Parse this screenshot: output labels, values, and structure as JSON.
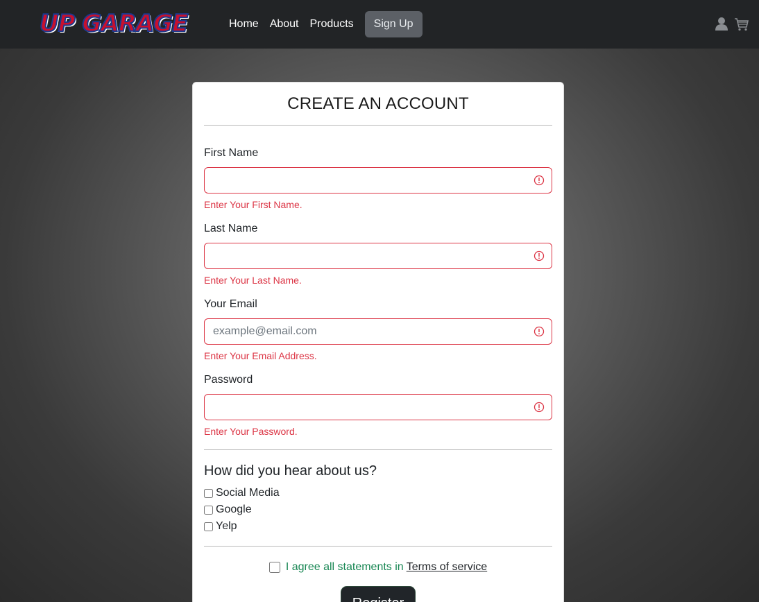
{
  "nav": {
    "brand": "UP GARAGE",
    "links": [
      "Home",
      "About",
      "Products"
    ],
    "signup": "Sign Up",
    "icons": [
      "user-icon",
      "cart-icon"
    ]
  },
  "form": {
    "title": "CREATE AN ACCOUNT",
    "fields": [
      {
        "label": "First Name",
        "value": "",
        "placeholder": "",
        "error": "Enter Your First Name."
      },
      {
        "label": "Last Name",
        "value": "",
        "placeholder": "",
        "error": "Enter Your Last Name."
      },
      {
        "label": "Your Email",
        "value": "",
        "placeholder": "example@email.com",
        "error": "Enter Your Email Address."
      },
      {
        "label": "Password",
        "value": "",
        "placeholder": "",
        "error": "Enter Your Password."
      }
    ],
    "hear_title": "How did you hear about us?",
    "options": [
      "Social Media",
      "Google",
      "Yelp"
    ],
    "agree_text": "I agree all statements in",
    "tos_link": "Terms of service",
    "register": "Register"
  },
  "colors": {
    "error": "#dc3545",
    "success": "#198754",
    "navbar": "#222426",
    "button": "#212529"
  }
}
